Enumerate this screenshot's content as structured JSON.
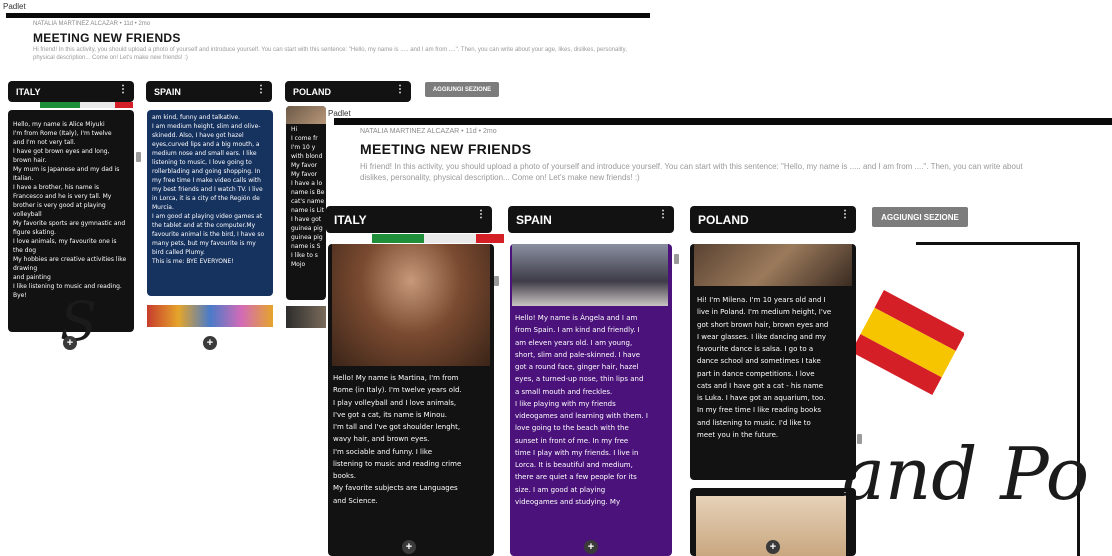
{
  "app_name": "Padlet",
  "board": {
    "author": "NATALIA MARTINEZ ALCAZAR • 11d • 2mo",
    "title": "MEETING NEW FRIENDS",
    "description_a": "Hi friend! In this activity, you should upload a photo of yourself and introduce yourself. You can start with this sentence: \"Hello, my name is ..... and I am from ....\". Then, you can write about your age, likes, dislikes, personality, physical description... Come on! Let's make new friends! :)",
    "description_b_line1": "Hi friend! In this activity, you should upload a photo of yourself and introduce yourself. You can start with this sentence: \"Hello, my name is ..... and I am from ....\". Then, you can write about",
    "description_b_line2": "dislikes, personality, physical description... Come on! Let's make new friends! :)",
    "add_section_label": "AGGIUNGI SEZIONE",
    "add_post_symbol": "+",
    "background_text": "and Po"
  },
  "sections": [
    {
      "name": "ITALY",
      "menu_icon": "more-vertical-icon"
    },
    {
      "name": "SPAIN",
      "menu_icon": "more-vertical-icon"
    },
    {
      "name": "POLAND",
      "menu_icon": "more-vertical-icon"
    }
  ],
  "shot_a_posts": {
    "italy": "Hello, my name is Alice Miyuki\nI'm from Rome (Italy), I'm twelve\nand I'm not very tall.\nI have got brown eyes and long,\nbrown hair.\nMy mum is Japanese and my dad is\nItalian.\nI have a brother, his name is\nFrancesco and he is very tall. My\nbrother is very good at playing\nvolleyball\nMy favorite sports are gymnastic and\nfigure skating.\nI love animals, my favourite one is\nthe dog\nMy hobbies are creative activities like\ndrawing\nand painting\nI like listening to music and reading.\nBye!",
    "spain": "am kind, funny and talkative.\nI am medium height, slim and olive-\nskinedd. Also, I have got hazel\neyes,curved lips and a big mouth, a\nmedium nose and small ears. I like\nlistening to music, I love going to\nrollerblading and going shopping. In\nmy free time I make video calls with\nmy best friends and I watch TV. I live\nin Lorca, it is a city of the Región de\nMurcia.\nI am good at playing video games at\nthe tablet and at the computer.My\nfavourite animal is the bird, I have so\nmany pets, but my favourite is my\nbird called Plumy.\nThis is me: BYE EVERYONE!",
    "poland": "Hi\nI come fr\nI'm 10 y\nwith blond\nMy favor\nMy favor\nI have a lo\nname is Be\ncat's name\nname is Lit\nI have got\nguinea pig\nguinea pig\nname is S\nI like to s\nMojo"
  },
  "shot_b_posts": {
    "italy": "Hello! My name is Martina, I'm from\nRome (in Italy). I'm twelve years old.\nI play volleyball and I love animals,\nI've got a cat, its name is Minou.\nI'm tall and I've got shoulder lenght,\nwavy hair, and brown eyes.\nI'm sociable and funny. I like\nlistening to music and reading crime\nbooks.\nMy favorite subjects are Languages\nand Science.",
    "spain": "Hello! My name is Ángela and I am\nfrom Spain. I am kind and friendly. I\nam eleven years old. I am young,\nshort, slim and pale-skinned. I have\ngot a round face, ginger hair, hazel\neyes, a turned-up nose, thin lips and\na small mouth and freckles.\nI like playing with my friends\nvideogames and learning with them. I\nlove going to the beach with the\nsunset in front of me. In my free\ntime I play with my friends. I live in\nLorca. It is beautiful and medium,\nthere are quiet a few people for its\nsize. I am good at playing\nvideogames and studying. My",
    "poland": "Hi! I'm Milena. I'm 10 years old and I\nlive in Poland. I'm medium height, I've\ngot short brown hair, brown eyes and\nI wear glasses. I like dancing and my\nfavourite dance is salsa. I go to a\ndance school and sometimes I take\npart in dance competitions. I love\ncats and I have got a cat - his name\nis Luka. I have got an aquarium, too.\nIn my free time I like reading books\nand listening to music. I'd like to\nmeet you in the future."
  },
  "colors": {
    "header_bg": "#121212",
    "card_dark": "#121212",
    "card_blue": "#16325f",
    "card_purple": "#4a127a",
    "add_section_bg": "#7c7c7c",
    "spain_flag_red": "#d41f26",
    "spain_flag_yellow": "#f7c400",
    "italy_flag_green": "#1f8f3a"
  }
}
